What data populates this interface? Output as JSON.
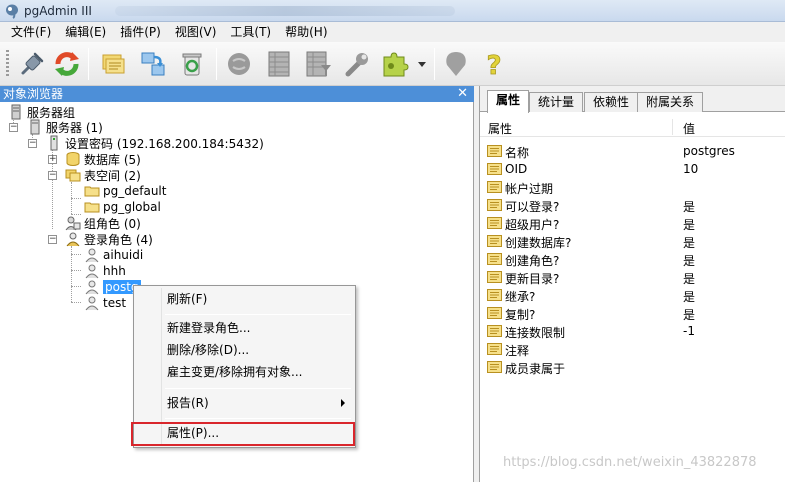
{
  "window": {
    "title": "pgAdmin III"
  },
  "menu": [
    "文件(F)",
    "编辑(E)",
    "插件(P)",
    "视图(V)",
    "工具(T)",
    "帮助(H)"
  ],
  "toolbar": {
    "buttons": [
      {
        "icon": "plug-connect-icon",
        "color": "#5b6b7c"
      },
      {
        "icon": "refresh-icon",
        "color": "#e04a28"
      },
      {
        "icon": "folder-properties-icon",
        "color": "#e8c44a"
      },
      {
        "icon": "create-object-icon",
        "color": "#3a8fd6"
      },
      {
        "icon": "recycle-bin-delete-icon",
        "color": "#3aa04a"
      },
      {
        "icon": "sql-query-icon",
        "color": "#8a8a8a"
      },
      {
        "icon": "view-data-icon",
        "color": "#8a8a8a"
      },
      {
        "icon": "filtered-data-icon",
        "color": "#8a8a8a"
      },
      {
        "icon": "maintenance-wrench-icon",
        "color": "#8a8a8a"
      },
      {
        "icon": "plugins-puzzle-icon",
        "color": "#9bbb2e"
      },
      {
        "icon": "hint-icon",
        "color": "#8a8a8a"
      },
      {
        "icon": "help-question-icon",
        "color": "#e2d33a"
      }
    ]
  },
  "object_browser": {
    "title": "对象浏览器",
    "close_glyph": "✕",
    "tree": {
      "root": "服务器组",
      "servers": "服务器 (1)",
      "server": "设置密码 (192.168.200.184:5432)",
      "databases": "数据库 (5)",
      "tablespaces": "表空间 (2)",
      "ts_default": "pg_default",
      "ts_global": "pg_global",
      "group_roles": "组角色 (0)",
      "login_roles": "登录角色 (4)",
      "roles": [
        "aihuidi",
        "hhh",
        "postgres",
        "test"
      ],
      "selected_role_visible": "postg"
    }
  },
  "context_menu": {
    "refresh": "刷新(F)",
    "new_login_role": "新建登录角色...",
    "delete": "删除/移除(D)...",
    "reassign": "雇主变更/移除拥有对象...",
    "report": "报告(R)",
    "properties": "属性(P)..."
  },
  "properties_panel": {
    "tabs": [
      "属性",
      "统计量",
      "依赖性",
      "附属关系"
    ],
    "active_tab": "属性",
    "columns": {
      "name": "属性",
      "value": "值"
    },
    "rows": [
      {
        "name": "名称",
        "value": "postgres"
      },
      {
        "name": "OID",
        "value": "10"
      },
      {
        "name": "帐户过期",
        "value": ""
      },
      {
        "name": "可以登录?",
        "value": "是"
      },
      {
        "name": "超级用户?",
        "value": "是"
      },
      {
        "name": "创建数据库?",
        "value": "是"
      },
      {
        "name": "创建角色?",
        "value": "是"
      },
      {
        "name": "更新目录?",
        "value": "是"
      },
      {
        "name": "继承?",
        "value": "是"
      },
      {
        "name": "复制?",
        "value": "是"
      },
      {
        "name": "连接数限制",
        "value": "-1"
      },
      {
        "name": "注释",
        "value": ""
      },
      {
        "name": "成员隶属于",
        "value": ""
      }
    ]
  },
  "watermark": "https://blog.csdn.net/weixin_43822878",
  "colors": {
    "selection": "#3399ff",
    "panel_header": "#4d8fd8",
    "highlight_border": "#d9262c"
  }
}
